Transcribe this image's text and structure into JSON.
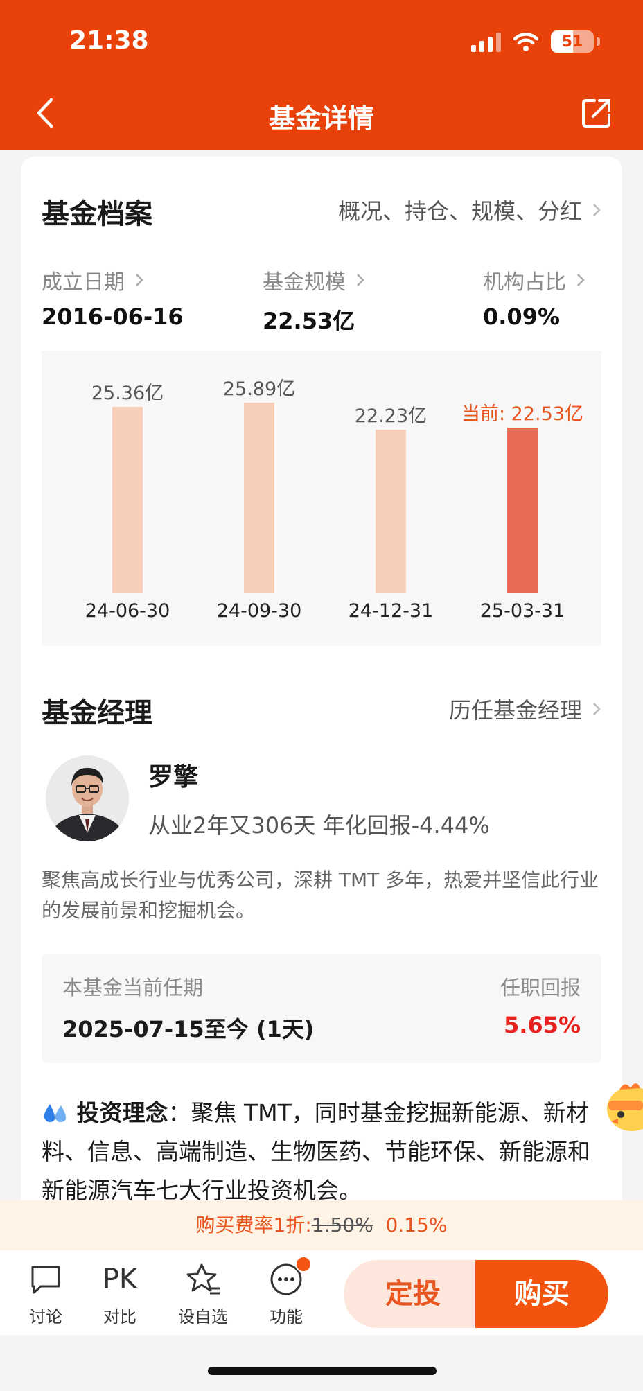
{
  "status": {
    "time": "21:38",
    "battery": "51"
  },
  "header": {
    "title": "基金详情"
  },
  "profile": {
    "title": "基金档案",
    "link": "概况、持仓、规模、分红",
    "stats": [
      {
        "label": "成立日期",
        "value": "2016-06-16"
      },
      {
        "label": "基金规模",
        "value": "22.53亿"
      },
      {
        "label": "机构占比",
        "value": "0.09%"
      }
    ]
  },
  "chart_data": {
    "type": "bar",
    "categories": [
      "24-06-30",
      "24-09-30",
      "24-12-31",
      "25-03-31"
    ],
    "values": [
      25.36,
      25.89,
      22.23,
      22.53
    ],
    "value_labels": [
      "25.36亿",
      "25.89亿",
      "22.23亿",
      "当前: 22.53亿"
    ],
    "unit": "亿",
    "highlight_index": 3,
    "colors": {
      "bar": "#f6cdb6",
      "current": "#e86b55"
    }
  },
  "manager": {
    "title": "基金经理",
    "link": "历任基金经理",
    "name": "罗擎",
    "meta": "从业2年又306天 年化回报-4.44%",
    "desc": "聚焦高成长行业与优秀公司，深耕 TMT 多年，热爱并坚信此行业的发展前景和挖掘机会。",
    "tenure_label": "本基金当前任期",
    "tenure_value": "2025-07-15至今 (1天)",
    "return_label": "任职回报",
    "return_value": "5.65%",
    "philosophy_label": "投资理念",
    "philosophy_text": "：聚焦 TMT，同时基金挖掘新能源、新材料、信息、高端制造、生物医药、节能环保、新能源和新能源汽车七大行业投资机会。"
  },
  "fee": {
    "prefix": "购买费率1折:",
    "original": "1.50%",
    "discounted": "0.15%"
  },
  "tabbar": {
    "discuss": "讨论",
    "compare_icon": "PK",
    "compare": "对比",
    "watchlist": "设自选",
    "functions": "功能",
    "sip": "定投",
    "buy": "购买"
  },
  "colors": {
    "brand": "#e8420a",
    "accent": "#f2540f",
    "positive": "#e8201e"
  }
}
